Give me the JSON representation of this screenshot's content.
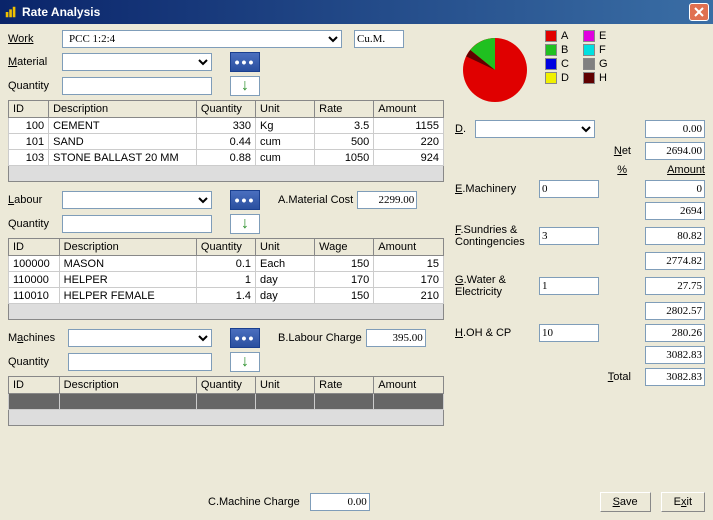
{
  "window": {
    "title": "Rate Analysis"
  },
  "work": {
    "label": "Work",
    "value": "PCC 1:2:4",
    "unit": "Cu.M."
  },
  "material": {
    "label": "Material",
    "value": "",
    "qty_label": "Quantity",
    "qty_value": ""
  },
  "material_table": {
    "headers": [
      "ID",
      "Description",
      "Quantity",
      "Unit",
      "Rate",
      "Amount"
    ],
    "rows": [
      [
        "100",
        "CEMENT",
        "330",
        "Kg",
        "3.5",
        "1155"
      ],
      [
        "101",
        "SAND",
        "0.44",
        "cum",
        "500",
        "220"
      ],
      [
        "103",
        "STONE BALLAST 20 MM",
        "0.88",
        "cum",
        "1050",
        "924"
      ]
    ]
  },
  "labour": {
    "label": "Labour",
    "value": "",
    "qty_label": "Quantity",
    "qty_value": "",
    "a_label": "A.Material Cost",
    "a_value": "2299.00"
  },
  "labour_table": {
    "headers": [
      "ID",
      "Description",
      "Quantity",
      "Unit",
      "Wage",
      "Amount"
    ],
    "rows": [
      [
        "100000",
        "MASON",
        "0.1",
        "Each",
        "150",
        "15"
      ],
      [
        "110000",
        "HELPER",
        "1",
        "day",
        "170",
        "170"
      ],
      [
        "110010",
        "HELPER FEMALE",
        "1.4",
        "day",
        "150",
        "210"
      ]
    ]
  },
  "machines": {
    "label": "Machines",
    "value": "",
    "qty_label": "Quantity",
    "qty_value": "",
    "b_label": "B.Labour Charge",
    "b_value": "395.00"
  },
  "machines_table": {
    "headers": [
      "ID",
      "Description",
      "Quantity",
      "Unit",
      "Rate",
      "Amount"
    ]
  },
  "footer": {
    "c_label": "C.Machine Charge",
    "c_value": "0.00",
    "save": "Save",
    "exit": "Exit"
  },
  "chart_data": {
    "type": "pie",
    "categories": [
      "A",
      "B",
      "C",
      "D",
      "E",
      "F",
      "G",
      "H"
    ],
    "values": [
      2299,
      395,
      0,
      0,
      0,
      0,
      0,
      0
    ],
    "colors": [
      "#E00000",
      "#20C020",
      "#0000E0",
      "#F0F000",
      "#E000E0",
      "#00E0E0",
      "#808080",
      "#600000"
    ],
    "legend_labels": [
      "A",
      "B",
      "C",
      "D",
      "E",
      "F",
      "G",
      "H"
    ]
  },
  "summary": {
    "d_label": "D.",
    "d_select": "",
    "d_val": "0.00",
    "net_label": "Net",
    "net_val": "2694.00",
    "pct_label": "%",
    "amt_label": "Amount",
    "e_label": "E.Machinery",
    "e_pct": "0",
    "e_amt": "0",
    "sub1": "2694",
    "f_label": "F.Sundries & Contingencies",
    "f_pct": "3",
    "f_amt": "80.82",
    "sub2": "2774.82",
    "g_label": "G.Water & Electricity",
    "g_pct": "1",
    "g_amt": "27.75",
    "sub3": "2802.57",
    "h_label": "H.OH & CP",
    "h_pct": "10",
    "h_amt": "280.26",
    "sub4": "3082.83",
    "total_label": "Total",
    "total_val": "3082.83"
  }
}
